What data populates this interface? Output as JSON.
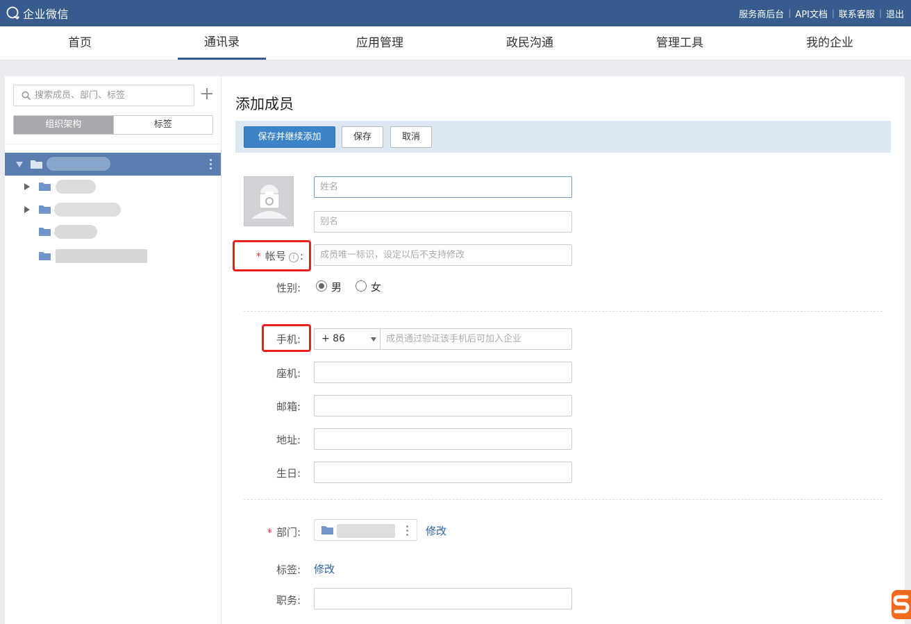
{
  "app": {
    "title": "企业微信"
  },
  "topbar": {
    "links": [
      "服务商后台",
      "API文档",
      "联系客服",
      "退出"
    ]
  },
  "nav": {
    "tabs": [
      {
        "label": "首页"
      },
      {
        "label": "通讯录"
      },
      {
        "label": "应用管理"
      },
      {
        "label": "政民沟通"
      },
      {
        "label": "管理工具"
      },
      {
        "label": "我的企业"
      }
    ],
    "active": "通讯录"
  },
  "sidebar": {
    "search_placeholder": "搜索成员、部门、标签",
    "segments": [
      "组织架构",
      "标签"
    ],
    "active_segment": "组织架构"
  },
  "form": {
    "title": "添加成员",
    "buttons": {
      "save_continue": "保存并继续添加",
      "save": "保存",
      "cancel": "取消"
    },
    "name_placeholder": "姓名",
    "alias_placeholder": "别名",
    "account_label": "帐号",
    "account_placeholder": "成员唯一标识，设定以后不支持修改",
    "gender_label": "性别:",
    "gender_options": [
      "男",
      "女"
    ],
    "gender_selected": "男",
    "mobile_label": "手机:",
    "country_code": "+ 86",
    "mobile_placeholder": "成员通过验证该手机后可加入企业",
    "phone_label": "座机:",
    "email_label": "邮箱:",
    "address_label": "地址:",
    "birthday_label": "生日:",
    "dept_label": "部门:",
    "dept_modify": "修改",
    "tag_label": "标签:",
    "tag_modify": "修改",
    "position_label": "职务:",
    "required_mark": "*",
    "colon": ":"
  },
  "colors": {
    "topbar": "#375b8d",
    "accent": "#3c83c8",
    "highlight": "#e8201c",
    "link": "#2b5fa2"
  }
}
